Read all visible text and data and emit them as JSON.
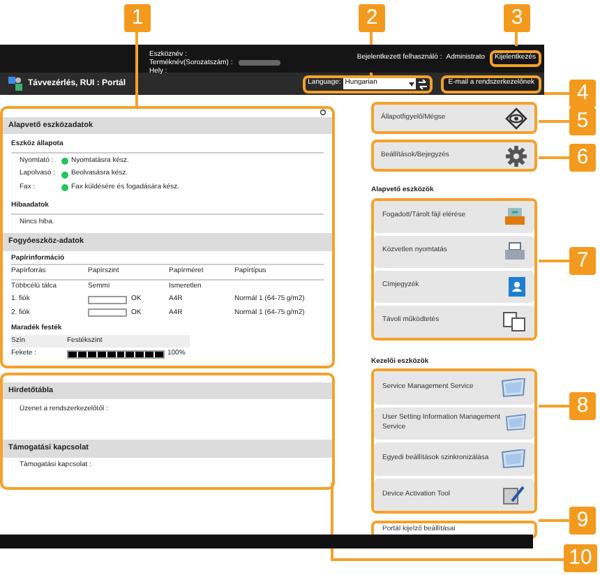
{
  "callouts": [
    "1",
    "2",
    "3",
    "4",
    "5",
    "6",
    "7",
    "8",
    "9",
    "10"
  ],
  "header": {
    "device_label": "Eszköznév :",
    "product_label": "Terméknév(Sorozatszám) :",
    "location_label": "Hely :",
    "user_label": "Bejelentkezett felhasználó :",
    "user": "Administrato",
    "logout": "Kijelentkezés",
    "title": "Távvezérlés, RUI : Portál",
    "language_label": "Language:",
    "language": "Hungarian",
    "email_button": "E-mail a rendszerkezelőnek"
  },
  "device_info": {
    "title": "Alapvető eszközadatok",
    "status_title": "Eszköz állapota",
    "status": [
      {
        "label": "Nyomtató :",
        "text": "Nyomtatásra kész.",
        "color": "#22c55e"
      },
      {
        "label": "Lapolvasó :",
        "text": "Beolvasásra kész.",
        "color": "#22c55e"
      },
      {
        "label": "Fax :",
        "text": "Fax küldésére és fogadására kész.",
        "color": "#22c55e"
      }
    ],
    "error_title": "Hibaadatok",
    "error_text": "Nincs hiba."
  },
  "consumables": {
    "title": "Fogyóeszköz-adatok",
    "paper_title": "Papírinformáció",
    "columns": [
      "Papírforrás",
      "Papírszint",
      "Papírméret",
      "Papírtípus"
    ],
    "rows": [
      {
        "source": "Többcélú tálca",
        "level_text": "Semmi",
        "size": "Ismeretlen"
      },
      {
        "source": "1. fiók",
        "kind": "gauge",
        "level_text": "OK",
        "size": "A4R",
        "type": "Normál 1 (64-75 g/m2)"
      },
      {
        "source": "2. fiók",
        "kind": "gauge",
        "level_text": "OK",
        "size": "A4R",
        "type": "Normál 1 (64-75 g/m2)"
      }
    ],
    "toner_title": "Maradék festék",
    "toner_columns": [
      "Szín",
      "Festékszint"
    ],
    "toner": [
      {
        "color_name": "Fekete :",
        "level": 1,
        "reading": "100%"
      }
    ]
  },
  "notice": {
    "title": "Hirdetőtábla",
    "message_label": "Üzenet a rendszerkezelőtől :",
    "support_title": "Támogatási kapcsolat",
    "support_label": "Támogatási kapcsolat :"
  },
  "menu": [
    {
      "label": "Állapotfigyelő/Mégse"
    },
    {
      "label": "Beállítások/Bejegyzés"
    }
  ],
  "basic_tools": {
    "title": "Alapvető eszközök",
    "items": [
      {
        "label": "Fogadott/Tárolt fájl elérése"
      },
      {
        "label": "Közvetlen nyomtatás"
      },
      {
        "label": "Címjegyzék"
      },
      {
        "label": "Távoli működtetés"
      }
    ]
  },
  "admin_tools": {
    "title": "Kezelői eszközök",
    "items": [
      {
        "label": "Service Management Service"
      },
      {
        "label": "User Setting Information Management Service"
      },
      {
        "label": "Egyedi beállítások szinkronizálása"
      },
      {
        "label": "Device Activation Tool"
      }
    ]
  },
  "portal_link": "Portál kijelző beállításai"
}
